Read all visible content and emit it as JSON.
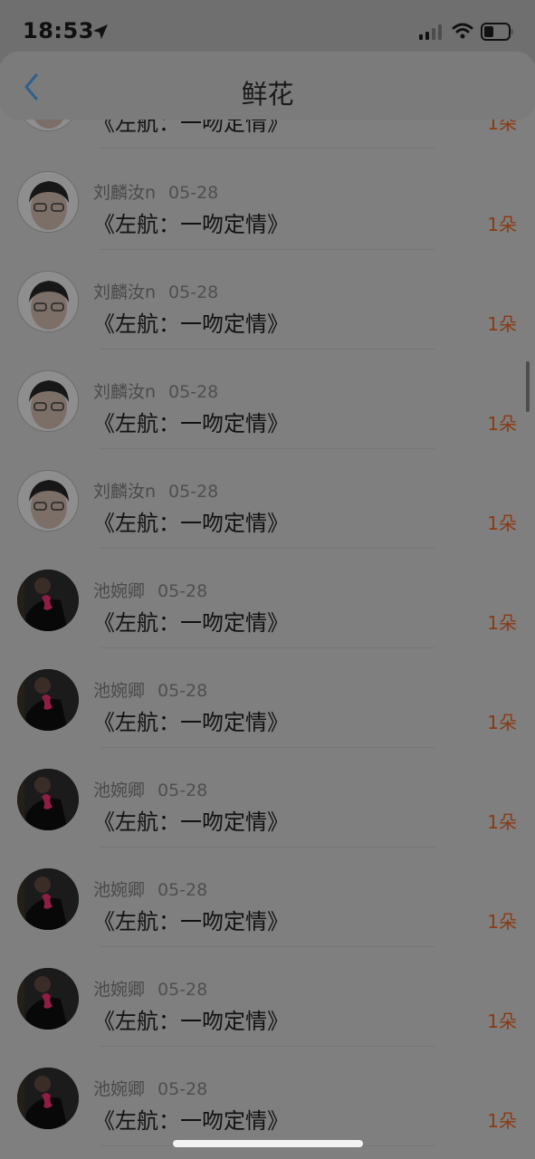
{
  "status_bar": {
    "time": "18:53"
  },
  "header": {
    "title": "鲜花"
  },
  "colors": {
    "accent": "#8a3a14",
    "back_arrow": "#2f5f8c"
  },
  "items": [
    {
      "avatar": "boy-avatar",
      "name": "",
      "date": "",
      "gift": "《左航：一吻定情》",
      "count": "1朵"
    },
    {
      "avatar": "boy-avatar",
      "name": "刘麟汝n",
      "date": "05-28",
      "gift": "《左航：一吻定情》",
      "count": "1朵"
    },
    {
      "avatar": "boy-avatar",
      "name": "刘麟汝n",
      "date": "05-28",
      "gift": "《左航：一吻定情》",
      "count": "1朵"
    },
    {
      "avatar": "boy-avatar",
      "name": "刘麟汝n",
      "date": "05-28",
      "gift": "《左航：一吻定情》",
      "count": "1朵"
    },
    {
      "avatar": "boy-avatar",
      "name": "刘麟汝n",
      "date": "05-28",
      "gift": "《左航：一吻定情》",
      "count": "1朵"
    },
    {
      "avatar": "girl-avatar",
      "name": "池婉卿",
      "date": "05-28",
      "gift": "《左航：一吻定情》",
      "count": "1朵"
    },
    {
      "avatar": "girl-avatar",
      "name": "池婉卿",
      "date": "05-28",
      "gift": "《左航：一吻定情》",
      "count": "1朵"
    },
    {
      "avatar": "girl-avatar",
      "name": "池婉卿",
      "date": "05-28",
      "gift": "《左航：一吻定情》",
      "count": "1朵"
    },
    {
      "avatar": "girl-avatar",
      "name": "池婉卿",
      "date": "05-28",
      "gift": "《左航：一吻定情》",
      "count": "1朵"
    },
    {
      "avatar": "girl-avatar",
      "name": "池婉卿",
      "date": "05-28",
      "gift": "《左航：一吻定情》",
      "count": "1朵"
    },
    {
      "avatar": "girl-avatar",
      "name": "池婉卿",
      "date": "05-28",
      "gift": "《左航：一吻定情》",
      "count": "1朵"
    }
  ]
}
